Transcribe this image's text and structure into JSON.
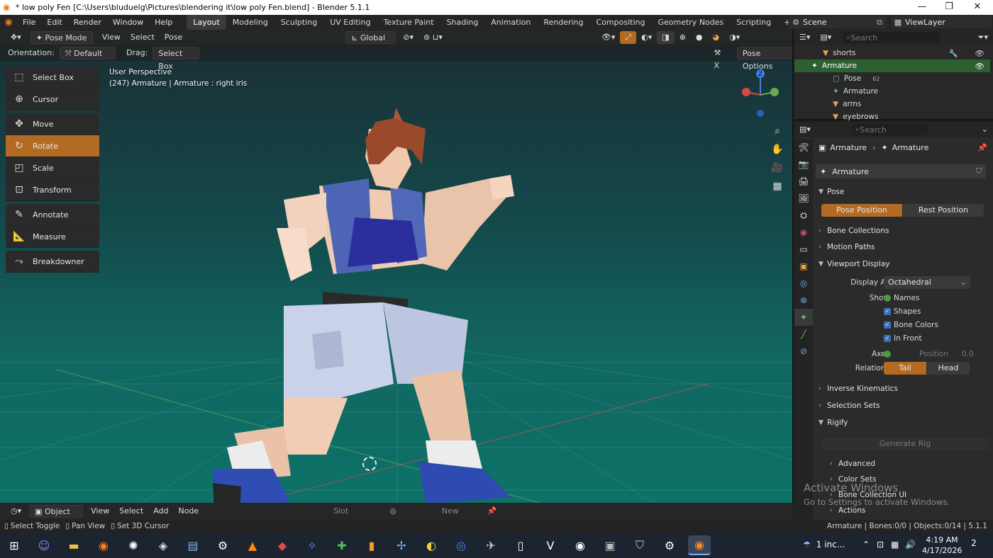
{
  "window": {
    "title": "* low poly Fen [C:\\Users\\bluduelg\\Pictures\\blendering it\\low poly Fen.blend] - Blender 5.1.1",
    "minimize": "—",
    "maximize": "❐",
    "close": "✕"
  },
  "menubar": {
    "items": [
      "File",
      "Edit",
      "Render",
      "Window",
      "Help"
    ],
    "workspaces": [
      "Layout",
      "Modeling",
      "Sculpting",
      "UV Editing",
      "Texture Paint",
      "Shading",
      "Animation",
      "Rendering",
      "Compositing",
      "Geometry Nodes",
      "Scripting"
    ],
    "active_workspace": "Layout",
    "add_tab": "+",
    "scene": "Scene",
    "view_layer": "ViewLayer"
  },
  "viewport": {
    "mode": "Pose Mode",
    "menus": [
      "View",
      "Select",
      "Pose"
    ],
    "transform_orientation": "Global",
    "orientation_label": "Orientation:",
    "orientation_value": "Default",
    "drag_label": "Drag:",
    "drag_value": "Select Box",
    "pose_options": "Pose Options",
    "perspective": "User Perspective",
    "context": "(247) Armature | Armature : right iris",
    "gizmo_axes": [
      "X",
      "Y",
      "Z"
    ]
  },
  "toolbar": {
    "tools": [
      "Select Box",
      "Cursor",
      "Move",
      "Rotate",
      "Scale",
      "Transform",
      "Annotate",
      "Measure",
      "Breakdowner"
    ],
    "active": "Rotate"
  },
  "timeline": {
    "mode": "Object",
    "menus": [
      "View",
      "Select",
      "Add",
      "Node"
    ],
    "slot": "Slot",
    "new": "New"
  },
  "statusbar": {
    "left": [
      "Select Toggle",
      "Pan View",
      "Set 3D Cursor"
    ],
    "right": "Armature | Bones:0/0 | Objects:0/14 | 5.1.1"
  },
  "outliner": {
    "search_placeholder": "Search",
    "rows": [
      {
        "label": "shorts",
        "indent": 1
      },
      {
        "label": "Armature",
        "indent": 0,
        "selected": true
      },
      {
        "label": "Pose",
        "indent": 2,
        "badge": "62"
      },
      {
        "label": "Armature",
        "indent": 2
      },
      {
        "label": "arms",
        "indent": 1
      },
      {
        "label": "eyebrows",
        "indent": 1
      }
    ]
  },
  "properties": {
    "search_placeholder": "Search",
    "breadcrumb": [
      "Armature",
      "Armature"
    ],
    "datablock": "Armature",
    "pose_panel": "Pose",
    "pose_position": "Pose Position",
    "rest_position": "Rest Position",
    "bone_collections": "Bone Collections",
    "motion_paths": "Motion Paths",
    "viewport_display": "Viewport Display",
    "display_as_label": "Display As",
    "display_as_value": "Octahedral",
    "show_label": "Show",
    "show_options": [
      "Names",
      "Shapes",
      "Bone Colors",
      "In Front"
    ],
    "axes_label": "Axes",
    "position_label": "Position",
    "position_value": "0.0",
    "relations_label": "Relations",
    "tail": "Tail",
    "head": "Head",
    "inverse_kinematics": "Inverse Kinematics",
    "selection_sets": "Selection Sets",
    "rigify": "Rigify",
    "generate_rig": "Generate Rig",
    "advanced": "Advanced",
    "color_sets": "Color Sets",
    "bone_collection_ui": "Bone Collection UI",
    "actions": "Actions"
  },
  "activation": {
    "title": "Activate Windows",
    "subtitle": "Go to Settings to activate Windows."
  },
  "taskbar": {
    "weather": "1 inc...",
    "time": "4:19 AM",
    "date": "4/17/2026",
    "notifications": "2"
  },
  "colors": {
    "accent_orange": "#b36b24",
    "outliner_selected": "#2c6030",
    "check_blue": "#3c6fbd"
  }
}
